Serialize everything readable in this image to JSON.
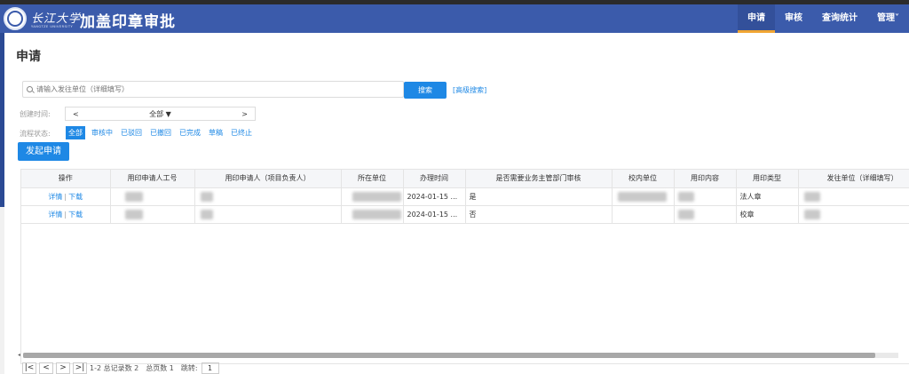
{
  "header": {
    "logo_script": "长江大学",
    "logo_sub": "YANGTZE UNIVERSITY",
    "app_title": "加盖印章审批",
    "nav": [
      {
        "label": "申请",
        "active": true
      },
      {
        "label": "审核",
        "active": false
      },
      {
        "label": "查询统计",
        "active": false
      },
      {
        "label": "管理",
        "active": false,
        "dropdown": true
      }
    ]
  },
  "page": {
    "title": "申请"
  },
  "search": {
    "placeholder": "请输入发往单位（详细填写）",
    "button_label": "搜索",
    "advanced_label": "[高级搜索]"
  },
  "filters": {
    "date_label": "创建时间:",
    "date_prev": "<",
    "date_value": "全部 ▼",
    "date_next": ">",
    "status_label": "流程状态:",
    "status_options": [
      "全部",
      "审核中",
      "已驳回",
      "已撤回",
      "已完成",
      "草稿",
      "已终止"
    ],
    "status_selected": "全部"
  },
  "actions": {
    "start_label": "发起申请"
  },
  "table": {
    "columns": [
      "操作",
      "用印申请人工号",
      "用印申请人（项目负责人）",
      "所在单位",
      "办理时间",
      "是否需要业务主管部门审核",
      "校内单位",
      "用印内容",
      "用印类型",
      "发往单位（详细填写）"
    ],
    "detail_label": "详情",
    "download_label": "下载",
    "rows": [
      {
        "time": "2024-01-15 ...",
        "need_review": "是",
        "seal_type": "法人章"
      },
      {
        "time": "2024-01-15 ...",
        "need_review": "否",
        "seal_type": "校章"
      }
    ]
  },
  "pager": {
    "first": "|<",
    "prev": "<",
    "next": ">",
    "last": ">|",
    "range_text": "1-2 总记录数 2",
    "pages_text": "总页数 1",
    "jump_label": "跳转:",
    "jump_value": "1"
  },
  "colors": {
    "header_bg": "#3b5bab",
    "accent": "#1e88e5",
    "active_underline": "#f0a533"
  }
}
